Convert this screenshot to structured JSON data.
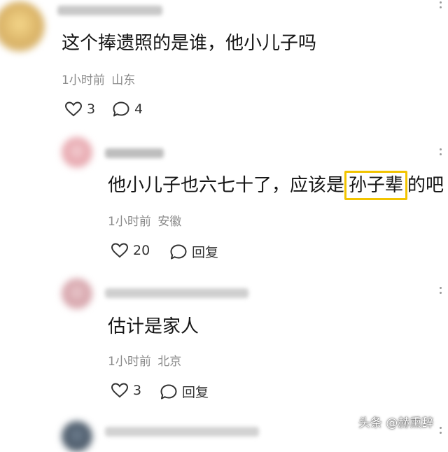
{
  "comments": [
    {
      "text": "这个捧遗照的是谁，他小儿子吗",
      "time": "1小时前",
      "location": "山东",
      "likes": "3",
      "replies": "4"
    },
    {
      "text_before": "他小儿子也六七十了，应该是",
      "text_highlight": "孙子辈",
      "text_after": "的吧",
      "time": "1小时前",
      "location": "安徽",
      "likes": "20",
      "reply_label": "回复"
    },
    {
      "text": "估计是家人",
      "time": "1小时前",
      "location": "北京",
      "likes": "3",
      "reply_label": "回复"
    }
  ],
  "watermark": "头条 @赫熏辞",
  "colors": {
    "highlight": "#f2c400",
    "meta": "#8a8a8a"
  },
  "icons": [
    "heart-icon",
    "comment-bubble-icon",
    "more-dots-icon"
  ]
}
